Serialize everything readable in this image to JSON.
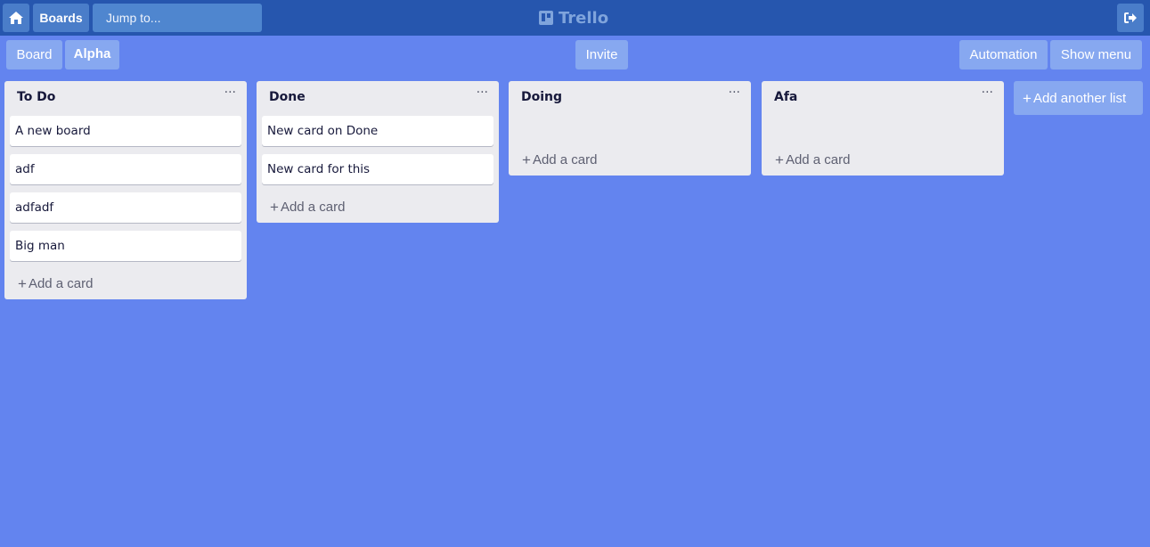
{
  "nav": {
    "home_icon": "home-icon",
    "boards_label": "Boards",
    "search_placeholder": "Jump to...",
    "logo_text": "Trello",
    "logout_icon": "sign-out-icon"
  },
  "board_header": {
    "board_label": "Board",
    "board_name": "Alpha",
    "invite_label": "Invite",
    "automation_label": "Automation",
    "show_menu_label": "Show menu"
  },
  "lists": [
    {
      "title": "To Do",
      "menu": "···",
      "cards": [
        "A new board",
        "adf",
        "adfadf",
        "Big man"
      ],
      "add_label": "Add a card"
    },
    {
      "title": "Done",
      "menu": "···",
      "cards": [
        "New card on Done",
        "New card for this"
      ],
      "add_label": "Add a card"
    },
    {
      "title": "Doing",
      "menu": "···",
      "cards": [],
      "add_label": "Add a card"
    },
    {
      "title": "Afa",
      "menu": "···",
      "cards": [],
      "add_label": "Add a card"
    }
  ],
  "add_list_label": "Add another list",
  "colors": {
    "background": "#6384ef",
    "topbar": "#2656ae",
    "list": "#ebebef"
  }
}
